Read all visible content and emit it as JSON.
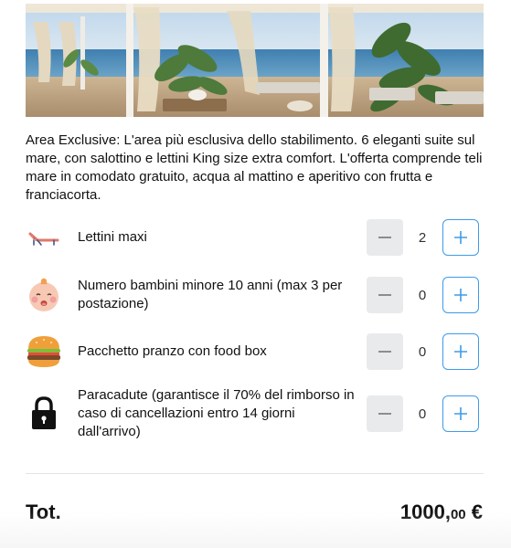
{
  "hero": {
    "alt": "beach-cabana-photo"
  },
  "description": "Area Exclusive: L'area più esclusiva dello stabilimento. 6 eleganti suite sul mare, con salottino e lettini King size extra comfort. L'offerta comprende teli mare in comodato gratuito, acqua al mattino e aperitivo con frutta e franciacorta.",
  "options": [
    {
      "icon": "sunbed-icon",
      "label": "Lettini maxi",
      "qty": "2"
    },
    {
      "icon": "baby-face-icon",
      "label": "Numero bambini minore 10 anni (max 3 per postazione)",
      "qty": "0"
    },
    {
      "icon": "burger-icon",
      "label": "Pacchetto pranzo con food box",
      "qty": "0"
    },
    {
      "icon": "lock-icon",
      "label": "Paracadute (garantisce il 70% del rimborso in caso di cancellazioni entro 14 giorni dall'arrivo)",
      "qty": "0"
    }
  ],
  "total": {
    "label": "Tot.",
    "amount_int": "1000,",
    "amount_dec": "00",
    "currency": "€"
  },
  "colors": {
    "accent": "#3d9be9",
    "minus_bg": "#e9eaec"
  }
}
